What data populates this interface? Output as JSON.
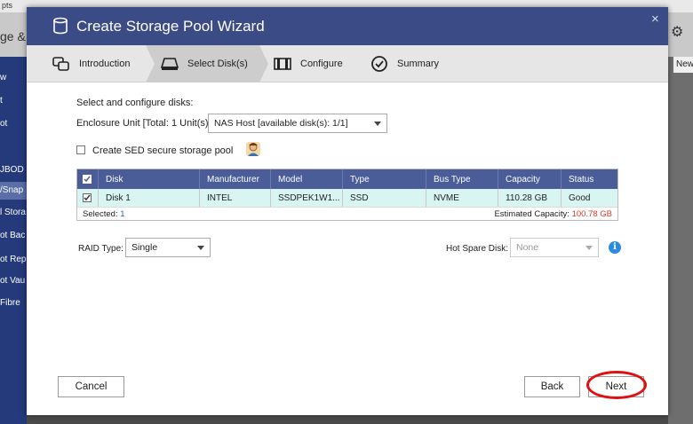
{
  "background": {
    "top_text": "pts",
    "title": "ge &",
    "sidebar_items": [
      "w",
      "t",
      "ot",
      "JBOD",
      "/Snap",
      "l Stora",
      "ot Bac",
      "ot Rep",
      "ot Vau",
      "Fibre"
    ],
    "right_tab": "New"
  },
  "dialog": {
    "title": "Create Storage Pool Wizard",
    "close": "×",
    "steps": [
      {
        "label": "Introduction",
        "icon": "introduction-icon"
      },
      {
        "label": "Select Disk(s)",
        "icon": "disk-icon",
        "active": true
      },
      {
        "label": "Configure",
        "icon": "configure-icon"
      },
      {
        "label": "Summary",
        "icon": "summary-check-icon"
      }
    ]
  },
  "form": {
    "section_title": "Select and configure disks:",
    "enclosure_label": "Enclosure Unit [Total: 1 Unit(s)]:",
    "enclosure_value": "NAS Host [available disk(s): 1/1]",
    "sed_label": "Create SED secure storage pool",
    "sed_checked": false,
    "raid_label": "RAID Type:",
    "raid_value": "Single",
    "hot_spare_label": "Hot Spare Disk:",
    "hot_spare_value": "None"
  },
  "table": {
    "headers": [
      "Disk",
      "Manufacturer",
      "Model",
      "Type",
      "Bus Type",
      "Capacity",
      "Status"
    ],
    "rows": [
      {
        "checked": true,
        "cells": [
          "Disk 1",
          "INTEL",
          "SSDPEK1W1...",
          "SSD",
          "NVME",
          "110.28 GB",
          "Good"
        ]
      }
    ],
    "selected_label": "Selected:",
    "selected_count": "1",
    "estimated_label": "Estimated Capacity:",
    "estimated_value": "100.78 GB"
  },
  "buttons": {
    "cancel": "Cancel",
    "back": "Back",
    "next": "Next"
  },
  "colors": {
    "header": "#3b4b86",
    "table_header": "#4a5d99",
    "selected_row": "#d8f5f1",
    "highlight_ring": "#e01010",
    "info": "#2a8be0"
  }
}
